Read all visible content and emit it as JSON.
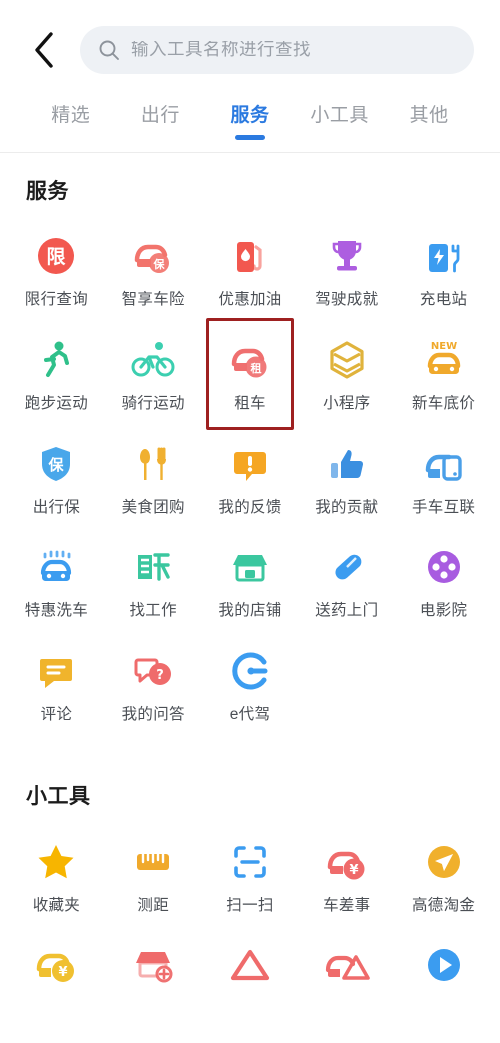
{
  "header": {
    "back_icon": "chevron-left-icon",
    "search": {
      "icon": "search-icon",
      "placeholder": "输入工具名称进行查找",
      "value": ""
    }
  },
  "tabs": [
    {
      "label": "精选",
      "active": false
    },
    {
      "label": "出行",
      "active": false
    },
    {
      "label": "服务",
      "active": true
    },
    {
      "label": "小工具",
      "active": false
    },
    {
      "label": "其他",
      "active": false
    }
  ],
  "theme": {
    "accent": "#2b7ae0",
    "highlight_box": "#9e2020",
    "search_bg": "#eef1f5",
    "label_color": "#4b4f55",
    "inactive_tab": "#9a9ea4"
  },
  "sections": [
    {
      "title": "服务",
      "items": [
        {
          "label": "限行查询",
          "icon": "restriction-badge-icon",
          "color": "#f2584f",
          "highlight": false
        },
        {
          "label": "智享车险",
          "icon": "car-insurance-icon",
          "color": "#f2746c",
          "highlight": false
        },
        {
          "label": "优惠加油",
          "icon": "fuel-pump-icon",
          "color": "#f2584f",
          "highlight": false
        },
        {
          "label": "驾驶成就",
          "icon": "trophy-icon",
          "color": "#ad5ee0",
          "highlight": false
        },
        {
          "label": "充电站",
          "icon": "charging-station-icon",
          "color": "#3b9cf0",
          "highlight": false
        },
        {
          "label": "跑步运动",
          "icon": "running-person-icon",
          "color": "#2fc08a",
          "highlight": false
        },
        {
          "label": "骑行运动",
          "icon": "cycling-icon",
          "color": "#3ccfb0",
          "highlight": false
        },
        {
          "label": "租车",
          "icon": "car-rental-icon",
          "color": "#ef6f6f",
          "highlight": true
        },
        {
          "label": "小程序",
          "icon": "mini-program-icon",
          "color": "#e0b33c",
          "highlight": false
        },
        {
          "label": "新车底价",
          "icon": "new-car-price-icon",
          "color": "#f0a92c",
          "badge": "NEW",
          "highlight": false
        },
        {
          "label": "出行保",
          "icon": "shield-insurance-icon",
          "color": "#49a7ea",
          "highlight": false
        },
        {
          "label": "美食团购",
          "icon": "food-groupbuy-icon",
          "color": "#f0b030",
          "highlight": false
        },
        {
          "label": "我的反馈",
          "icon": "feedback-bubble-icon",
          "color": "#f5a623",
          "highlight": false
        },
        {
          "label": "我的贡献",
          "icon": "thumbs-up-icon",
          "color": "#3b8fe0",
          "highlight": false
        },
        {
          "label": "手车互联",
          "icon": "car-phone-link-icon",
          "color": "#4a9fe8",
          "highlight": false
        },
        {
          "label": "特惠洗车",
          "icon": "car-wash-icon",
          "color": "#3b9cf0",
          "highlight": false
        },
        {
          "label": "找工作",
          "icon": "job-hiring-icon",
          "color": "#3bc79f",
          "highlight": false
        },
        {
          "label": "我的店铺",
          "icon": "my-shop-icon",
          "color": "#3bc79f",
          "highlight": false
        },
        {
          "label": "送药上门",
          "icon": "medicine-capsule-icon",
          "color": "#3b9cf0",
          "highlight": false
        },
        {
          "label": "电影院",
          "icon": "film-reel-icon",
          "color": "#a85ce0",
          "highlight": false
        },
        {
          "label": "评论",
          "icon": "comment-icon",
          "color": "#f0b42c",
          "highlight": false
        },
        {
          "label": "我的问答",
          "icon": "qa-bubbles-icon",
          "color": "#ef6b6b",
          "highlight": false
        },
        {
          "label": "e代驾",
          "icon": "edaijia-icon",
          "color": "#3b9cf0",
          "highlight": false
        }
      ]
    },
    {
      "title": "小工具",
      "items": [
        {
          "label": "收藏夹",
          "icon": "star-icon",
          "color": "#f7b500",
          "highlight": false
        },
        {
          "label": "测距",
          "icon": "ruler-icon",
          "color": "#f0a92c",
          "highlight": false
        },
        {
          "label": "扫一扫",
          "icon": "scan-frame-icon",
          "color": "#3b9cf0",
          "highlight": false
        },
        {
          "label": "车差事",
          "icon": "car-errand-icon",
          "color": "#ef6b6b",
          "highlight": false
        },
        {
          "label": "高德淘金",
          "icon": "gold-paperplane-icon",
          "color": "#f0b02c",
          "highlight": false
        },
        {
          "label": "",
          "icon": "car-coin-icon",
          "color": "#f0c030",
          "cut": true,
          "highlight": false
        },
        {
          "label": "",
          "icon": "shop-add-icon",
          "color": "#ef6b6b",
          "cut": true,
          "highlight": false
        },
        {
          "label": "",
          "icon": "warning-triangle-icon",
          "color": "#ef6b6b",
          "cut": true,
          "highlight": false
        },
        {
          "label": "",
          "icon": "car-accident-icon",
          "color": "#ef6b6b",
          "cut": true,
          "highlight": false
        },
        {
          "label": "",
          "icon": "play-circle-icon",
          "color": "#3b9cf0",
          "cut": true,
          "highlight": false
        }
      ]
    }
  ]
}
